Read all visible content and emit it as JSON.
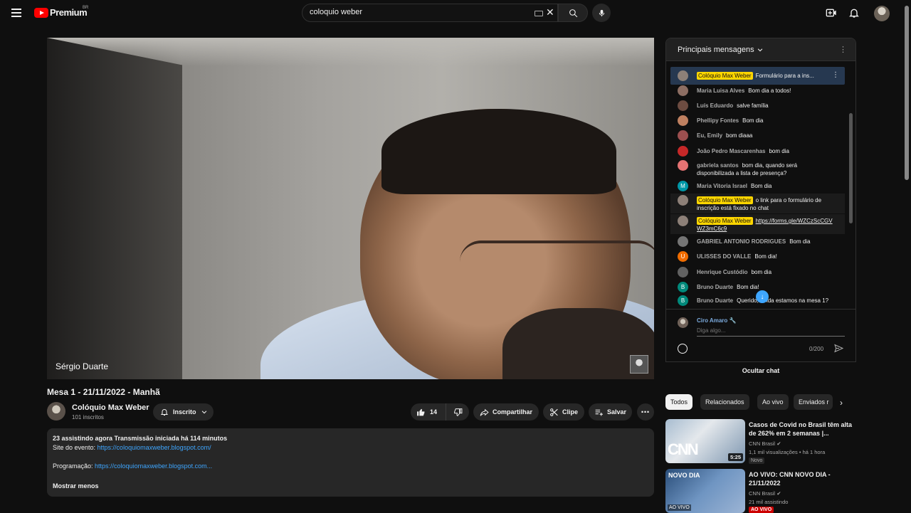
{
  "header": {
    "brand": "Premium",
    "region": "BR",
    "search_value": "coloquio weber"
  },
  "video": {
    "speaker_name": "Sérgio Duarte",
    "title": "Mesa 1 - 21/11/2022 - Manhã",
    "channel_name": "Colóquio Max Weber",
    "subscribers": "101 inscritos",
    "subscribe_label": "Inscrito",
    "like_count": "14",
    "share_label": "Compartilhar",
    "clip_label": "Clipe",
    "save_label": "Salvar"
  },
  "description": {
    "stats": "23 assistindo agora  Transmissão iniciada há 114 minutos",
    "site_label": "Site do evento: ",
    "site_link": "https://coloquiomaxweber.blogspot.com/",
    "program_label": "Programação: ",
    "program_link": "https://coloquiomaxweber.blogspot.com...",
    "show_less": "Mostrar menos"
  },
  "chat": {
    "header_title": "Principais mensagens",
    "pinned": {
      "author": "Colóquio Max Weber",
      "text": "Formulário para a ins..."
    },
    "messages": [
      {
        "author": "Maria Luisa Alves",
        "text": "Bom dia a todos!",
        "avatar_color": "#8d6e63",
        "initial": ""
      },
      {
        "author": "Luís Eduardo",
        "text": "salve família",
        "avatar_color": "#6d4c41",
        "initial": ""
      },
      {
        "author": "Phellipy Fontes",
        "text": "Bom dia",
        "avatar_color": "#bf8060",
        "initial": ""
      },
      {
        "author": "Eu, Emily",
        "text": "bom diaaa",
        "avatar_color": "#9c4f4f",
        "initial": ""
      },
      {
        "author": "João Pedro Mascarenhas",
        "text": "bom dia",
        "avatar_color": "#c62828",
        "initial": ""
      },
      {
        "author": "gabriela santos",
        "text": "bom dia, quando será disponibilizada a lista de presença?",
        "avatar_color": "#e57373",
        "initial": ""
      },
      {
        "author": "Maria Vitoria Israel",
        "text": "Bom dia",
        "avatar_color": "#0097a7",
        "initial": "M"
      },
      {
        "author": "Colóquio Max Weber",
        "text": "o link para o formulário de inscrição está fixado no chat",
        "avatar_color": "#8d8078",
        "initial": ""
      },
      {
        "author": "Colóquio Max Weber",
        "text": "https://forms.gle/WZCzScCGVWZ3mC6c9",
        "avatar_color": "#8d8078",
        "initial": ""
      },
      {
        "author": "GABRIEL ANTONIO RODRIGUES",
        "text": "Bom dia",
        "avatar_color": "#757575",
        "initial": ""
      },
      {
        "author": "ULISSES DO VALLE",
        "text": "Bom dia!",
        "avatar_color": "#ef6c00",
        "initial": "U"
      },
      {
        "author": "Henrique Custódio",
        "text": "bom dia",
        "avatar_color": "#616161",
        "initial": ""
      },
      {
        "author": "Bruno Duarte",
        "text": "Bom dia!",
        "avatar_color": "#00897b",
        "initial": "B"
      },
      {
        "author": "Bruno Duarte",
        "text": "Querido, ainda estamos na mesa 1?",
        "avatar_color": "#00897b",
        "initial": "B"
      }
    ],
    "input_user": "Ciro Amaro",
    "input_placeholder": "Diga algo...",
    "counter": "0/200",
    "hide_label": "Ocultar chat"
  },
  "filters": [
    "Todos",
    "Relacionados",
    "Ao vivo",
    "Enviados r"
  ],
  "recommendations": [
    {
      "title": "Casos de Covid no Brasil têm alta de 262% em 2 semanas |...",
      "channel": "CNN Brasil",
      "meta": "1,1 mil visualizações  •  há 1 hora",
      "badge": "Novo",
      "duration": "5:25",
      "thumb_brand": "CNN"
    },
    {
      "title": "AO VIVO: CNN NOVO DIA - 21/11/2022",
      "channel": "CNN Brasil",
      "meta": "21 mil assistindo",
      "badge": "AO VIVO",
      "thumb_label": "AO VIVO",
      "thumb_brand": "NOVO DIA"
    }
  ],
  "colors": {
    "accent_blue": "#3ea6ff",
    "mod_badge": "#ffd600",
    "live_red": "#cc0000",
    "brand_red": "#ff0000"
  }
}
